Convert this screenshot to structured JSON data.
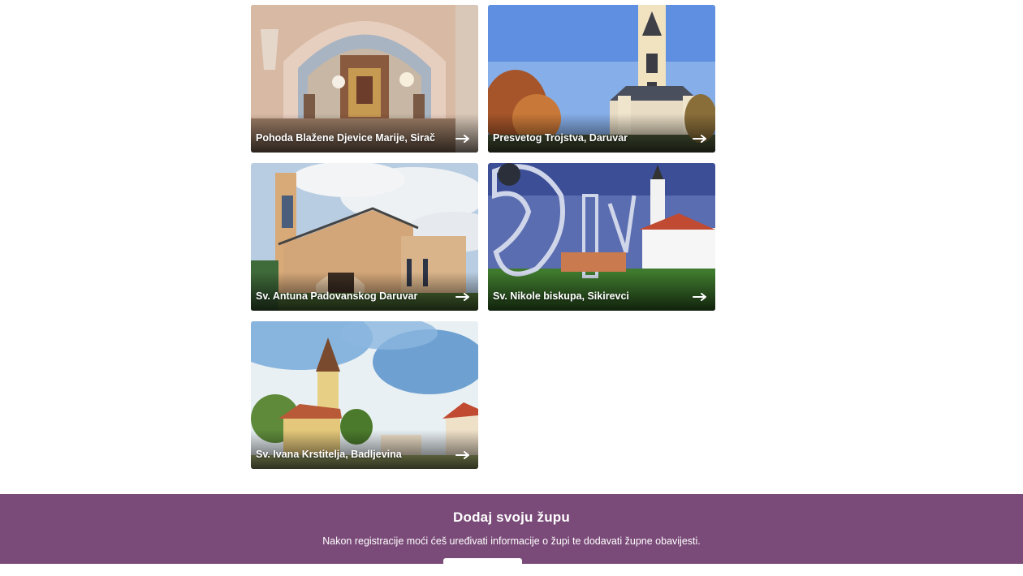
{
  "parishes": [
    {
      "name": "Pohoda Blažene Djevice Marije, Sirač",
      "scene": "church-interior"
    },
    {
      "name": "Presvetog Trojstva, Daruvar",
      "scene": "baroque-church-tower"
    },
    {
      "name": "Sv. Antuna Padovanskog Daruvar",
      "scene": "modern-church"
    },
    {
      "name": "Sv. Nikole biskupa, Sikirevci",
      "scene": "village-church-sign"
    },
    {
      "name": "Sv. Ivana Krstitelja, Badljevina",
      "scene": "watercolor-church"
    }
  ],
  "footer": {
    "title": "Dodaj svoju župu",
    "description": "Nakon registracije moći ćeš uređivati informacije o župi te dodavati župne obavijesti.",
    "button_label": ""
  },
  "colors": {
    "footer_background": "#7a4a78",
    "caption_text": "#ffffff"
  },
  "icons": {
    "card_arrow": "arrow-right-icon"
  }
}
